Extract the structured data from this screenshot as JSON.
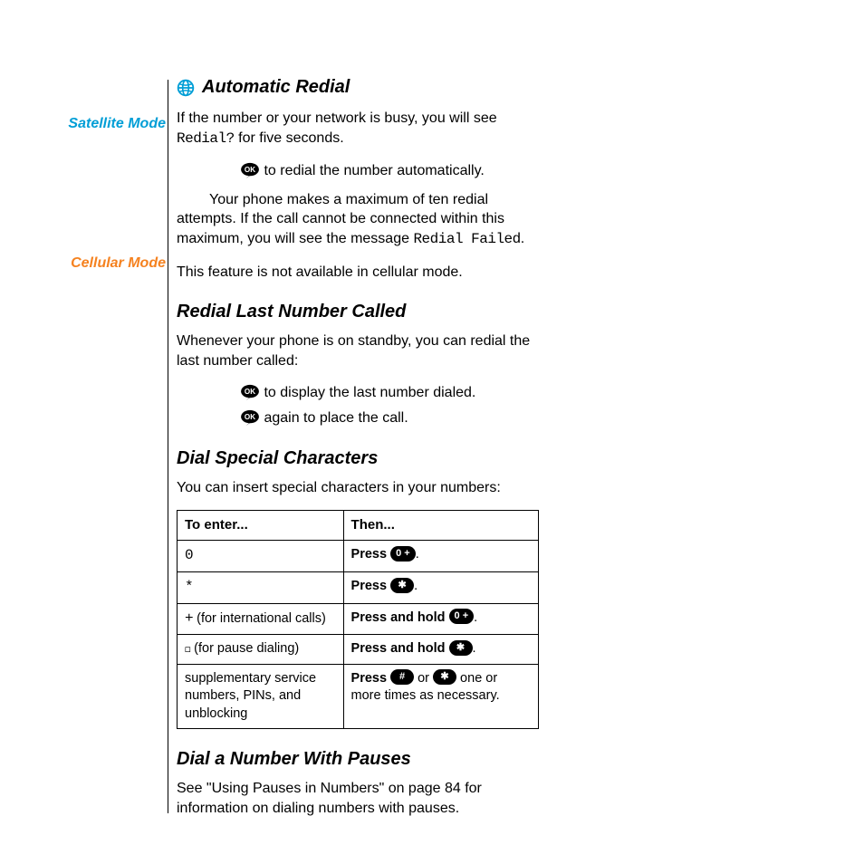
{
  "sidebar": {
    "satellite": "Satellite Mode",
    "cellular": "Cellular Mode"
  },
  "sec_auto_redial": {
    "heading": "Automatic Redial",
    "p1_a": "If the number or your network is busy, you will see ",
    "p1_mono": "Redial?",
    "p1_b": " for five seconds.",
    "ok1_after": " to redial the number automatically.",
    "p2_a": "Your phone makes a maximum of ten redial attempts. If the call cannot be connected within this maximum, you will see the message ",
    "p2_mono": "Redial Failed",
    "p2_b": ".",
    "p3": "This feature is not available in cellular mode."
  },
  "sec_redial_last": {
    "heading": "Redial Last Number Called",
    "p1": "Whenever your phone is on standby, you can redial the last number called:",
    "ok1_after": " to display the last number dialed.",
    "ok2_after": " again to place the call."
  },
  "sec_dial_special": {
    "heading": "Dial Special Characters",
    "p1": "You can insert special characters in your numbers:",
    "th1": "To enter...",
    "th2": "Then...",
    "r1c1": "0",
    "r1c2_b": "Press",
    "r1c2_key": "0 +",
    "r1c2_after": ".",
    "r2c1": "*",
    "r2c2_b": "Press",
    "r2c2_key": "✱",
    "r2c2_after": ".",
    "r3c1_sym": "+",
    "r3c1_txt": "  (for international calls)",
    "r3c2_b": "Press and hold",
    "r3c2_key": "0 +",
    "r3c2_after": ".",
    "r4c1_sym": "◻",
    "r4c1_txt": "  (for pause dialing)",
    "r4c2_b": "Press and hold",
    "r4c2_key": "✱",
    "r4c2_after": ".",
    "r5c1": "supplementary service numbers, PINs, and unblocking",
    "r5c2_b1": "Press",
    "r5c2_key1": "#",
    "r5c2_mid": " or ",
    "r5c2_key2": "✱",
    "r5c2_after": " one or more times as necessary."
  },
  "sec_pauses": {
    "heading": "Dial a Number With Pauses",
    "p1": "See \"Using Pauses in Numbers\" on page 84 for information on dialing numbers with pauses."
  }
}
